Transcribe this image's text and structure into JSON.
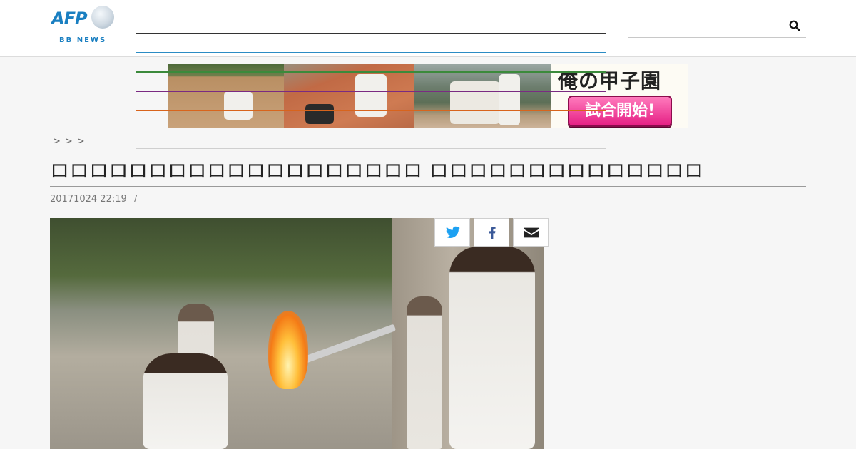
{
  "header": {
    "logo_text": "AFP",
    "logo_subtext": "BB NEWS",
    "search": {
      "icon": "search-icon",
      "placeholder": ""
    }
  },
  "ad_banner": {
    "title": "俺の甲子園",
    "button_label": "試合開始!"
  },
  "breadcrumb": ">>>",
  "article": {
    "headline": "ロロロロロロロロロロロロロロロロロロロ ロロロロロロロロロロロロロロ",
    "date": "20171024 22:19",
    "date_separator": "/"
  },
  "share": {
    "icons": [
      "twitter-icon",
      "facebook-icon",
      "mail-icon"
    ]
  },
  "colors": {
    "brand": "#1a7fc1",
    "twitter": "#1da1f2",
    "facebook": "#3b5998",
    "ad_button": "#e51f84"
  }
}
